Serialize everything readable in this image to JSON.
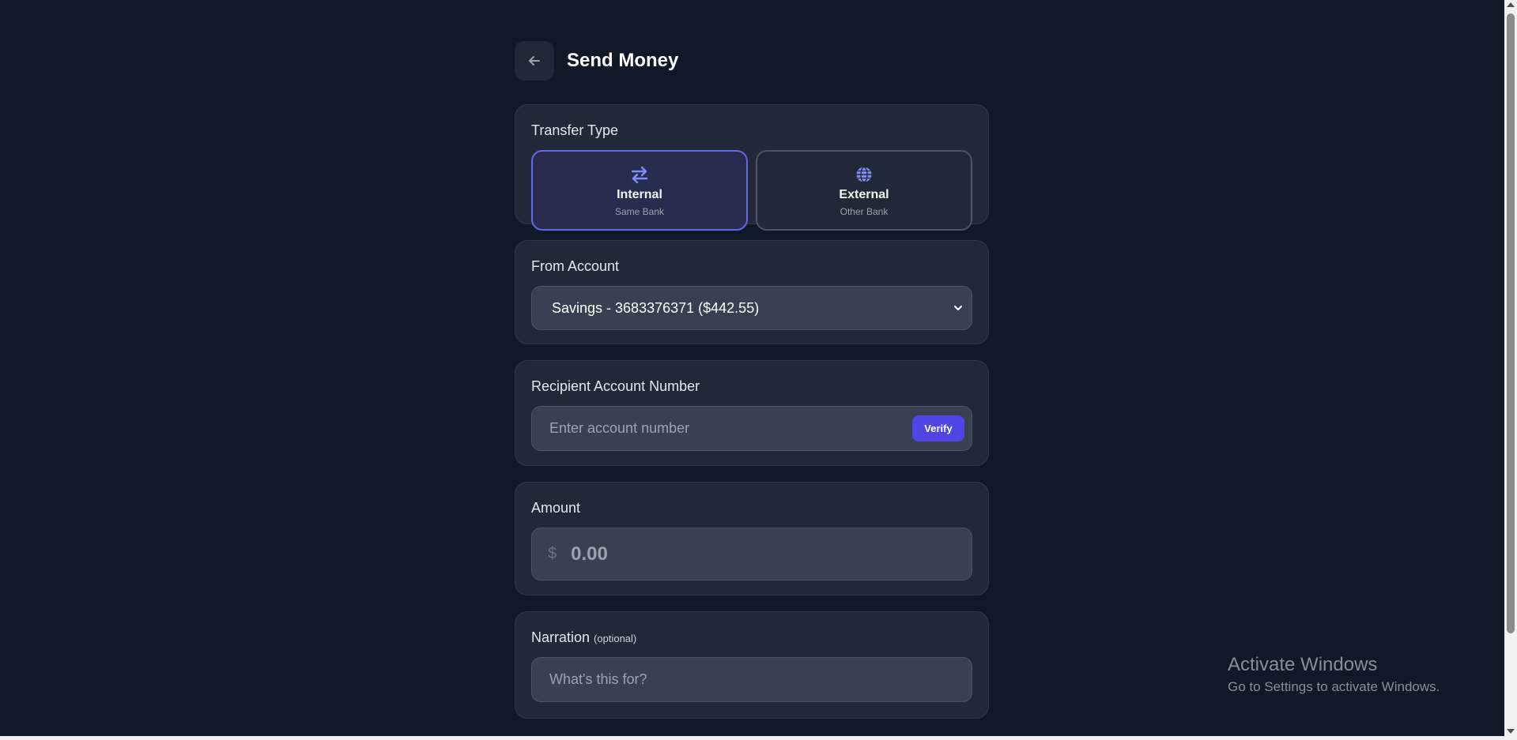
{
  "header": {
    "back_icon": "arrow-left-icon",
    "title": "Send Money"
  },
  "transfer_type": {
    "label": "Transfer Type",
    "options": [
      {
        "title": "Internal",
        "subtitle": "Same Bank",
        "icon": "swap-arrows-icon",
        "selected": true
      },
      {
        "title": "External",
        "subtitle": "Other Bank",
        "icon": "globe-icon",
        "selected": false
      }
    ]
  },
  "from_account": {
    "label": "From Account",
    "selected": "Savings - 3683376371 ($442.55)",
    "icon": "chevron-down-icon"
  },
  "recipient": {
    "label": "Recipient Account Number",
    "placeholder": "Enter account number",
    "verify_label": "Verify"
  },
  "amount": {
    "label": "Amount",
    "currency": "$",
    "placeholder": "0.00"
  },
  "narration": {
    "label": "Narration",
    "optional": "(optional)",
    "placeholder": "What's this for?"
  },
  "watermark": {
    "title": "Activate Windows",
    "subtitle": "Go to Settings to activate Windows."
  },
  "colors": {
    "background": "#111827",
    "card": "#1f2937",
    "accent": "#4f46e5",
    "accent_icon": "#818cf8"
  }
}
